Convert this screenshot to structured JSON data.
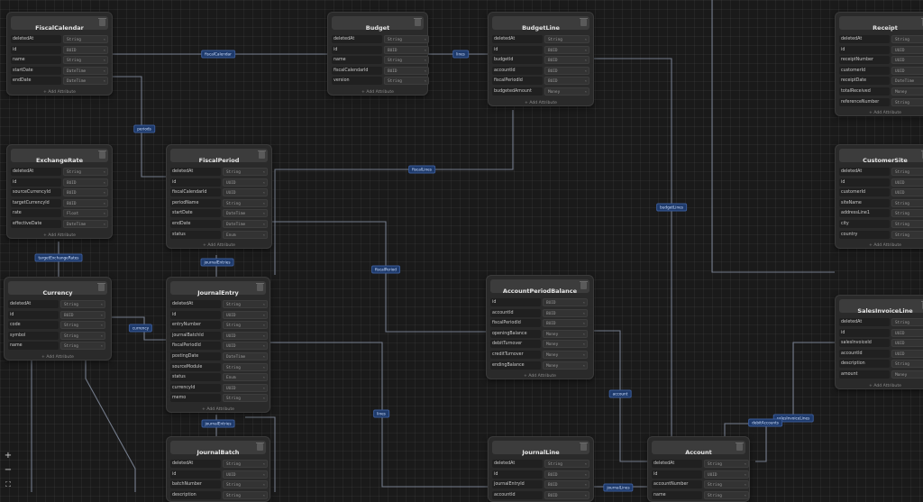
{
  "add_attribute_label": "+ Add Attribute",
  "zoom_controls": {
    "zoom_in": "+",
    "zoom_out": "−",
    "fit": "⛶"
  },
  "tables": [
    {
      "name": "FiscalCalendar",
      "fields": [
        [
          "deletedAt",
          "String"
        ],
        [
          "id",
          "BUID"
        ],
        [
          "name",
          "String"
        ],
        [
          "startDate",
          "DateTime"
        ],
        [
          "endDate",
          "DateTime"
        ]
      ]
    },
    {
      "name": "Budget",
      "fields": [
        [
          "deletedAt",
          "String"
        ],
        [
          "id",
          "BUID"
        ],
        [
          "name",
          "String"
        ],
        [
          "fiscalCalendarId",
          "BUID"
        ],
        [
          "version",
          "String"
        ]
      ]
    },
    {
      "name": "BudgetLine",
      "fields": [
        [
          "deletedAt",
          "String"
        ],
        [
          "id",
          "BUID"
        ],
        [
          "budgetId",
          "BUID"
        ],
        [
          "accountId",
          "BUID"
        ],
        [
          "fiscalPeriodId",
          "BUID"
        ],
        [
          "budgetedAmount",
          "Money"
        ]
      ]
    },
    {
      "name": "Receipt",
      "fields": [
        [
          "deletedAt",
          "String"
        ],
        [
          "id",
          "UUID"
        ],
        [
          "receiptNumber",
          "UUID"
        ],
        [
          "customerId",
          "UUID"
        ],
        [
          "receiptDate",
          "DateTime"
        ],
        [
          "totalReceived",
          "Money"
        ],
        [
          "referenceNumber",
          "String"
        ]
      ]
    },
    {
      "name": "ExchangeRate",
      "fields": [
        [
          "deletedAt",
          "String"
        ],
        [
          "id",
          "BUID"
        ],
        [
          "sourceCurrencyId",
          "BUID"
        ],
        [
          "targetCurrencyId",
          "BUID"
        ],
        [
          "rate",
          "Float"
        ],
        [
          "effectiveDate",
          "DateTime"
        ]
      ]
    },
    {
      "name": "FiscalPeriod",
      "fields": [
        [
          "deletedAt",
          "String"
        ],
        [
          "id",
          "UUID"
        ],
        [
          "fiscalCalendarId",
          "UUID"
        ],
        [
          "periodName",
          "String"
        ],
        [
          "startDate",
          "DateTime"
        ],
        [
          "endDate",
          "DateTime"
        ],
        [
          "status",
          "Enum"
        ]
      ]
    },
    {
      "name": "CustomerSite",
      "fields": [
        [
          "deletedAt",
          "String"
        ],
        [
          "id",
          "UUID"
        ],
        [
          "customerId",
          "UUID"
        ],
        [
          "siteName",
          "String"
        ],
        [
          "addressLine1",
          "String"
        ],
        [
          "city",
          "String"
        ],
        [
          "country",
          "String"
        ]
      ]
    },
    {
      "name": "Currency",
      "fields": [
        [
          "deletedAt",
          "String"
        ],
        [
          "id",
          "BUID"
        ],
        [
          "code",
          "String"
        ],
        [
          "symbol",
          "String"
        ],
        [
          "name",
          "String"
        ]
      ]
    },
    {
      "name": "JournalEntry",
      "fields": [
        [
          "deletedAt",
          "String"
        ],
        [
          "id",
          "UUID"
        ],
        [
          "entryNumber",
          "String"
        ],
        [
          "journalBatchId",
          "UUID"
        ],
        [
          "fiscalPeriodId",
          "UUID"
        ],
        [
          "postingDate",
          "DateTime"
        ],
        [
          "sourceModule",
          "String"
        ],
        [
          "status",
          "Enum"
        ],
        [
          "currencyId",
          "UUID"
        ],
        [
          "memo",
          "String"
        ]
      ]
    },
    {
      "name": "AccountPeriodBalance",
      "fields": [
        [
          "id",
          "BUID"
        ],
        [
          "accountId",
          "BUID"
        ],
        [
          "fiscalPeriodId",
          "BUID"
        ],
        [
          "openingBalance",
          "Money"
        ],
        [
          "debitTurnover",
          "Money"
        ],
        [
          "creditTurnover",
          "Money"
        ],
        [
          "endingBalance",
          "Money"
        ]
      ]
    },
    {
      "name": "SalesInvoiceLine",
      "fields": [
        [
          "deletedAt",
          "String"
        ],
        [
          "id",
          "UUID"
        ],
        [
          "salesInvoiceId",
          "UUID"
        ],
        [
          "accountId",
          "UUID"
        ],
        [
          "description",
          "String"
        ],
        [
          "amount",
          "Money"
        ]
      ]
    },
    {
      "name": "JournalBatch",
      "fields": [
        [
          "deletedAt",
          "String"
        ],
        [
          "id",
          "UUID"
        ],
        [
          "batchNumber",
          "String"
        ],
        [
          "description",
          "String"
        ]
      ]
    },
    {
      "name": "JournalLine",
      "fields": [
        [
          "deletedAt",
          "String"
        ],
        [
          "id",
          "BUID"
        ],
        [
          "journalEntryId",
          "BUID"
        ],
        [
          "accountId",
          "BUID"
        ]
      ]
    },
    {
      "name": "Account",
      "fields": [
        [
          "deletedAt",
          "String"
        ],
        [
          "id",
          "UUID"
        ],
        [
          "accountNumber",
          "String"
        ],
        [
          "name",
          "String"
        ]
      ]
    }
  ],
  "relation_labels": [
    "fiscalCalendar",
    "lines",
    "periods",
    "fiscalLines",
    "budgetLines",
    "targetExchangeRates",
    "journalEntries",
    "fiscalPeriod",
    "currency",
    "account",
    "lines",
    "journalEntries",
    "salesInvoiceLines",
    "debitAccounts",
    "journalLines"
  ]
}
